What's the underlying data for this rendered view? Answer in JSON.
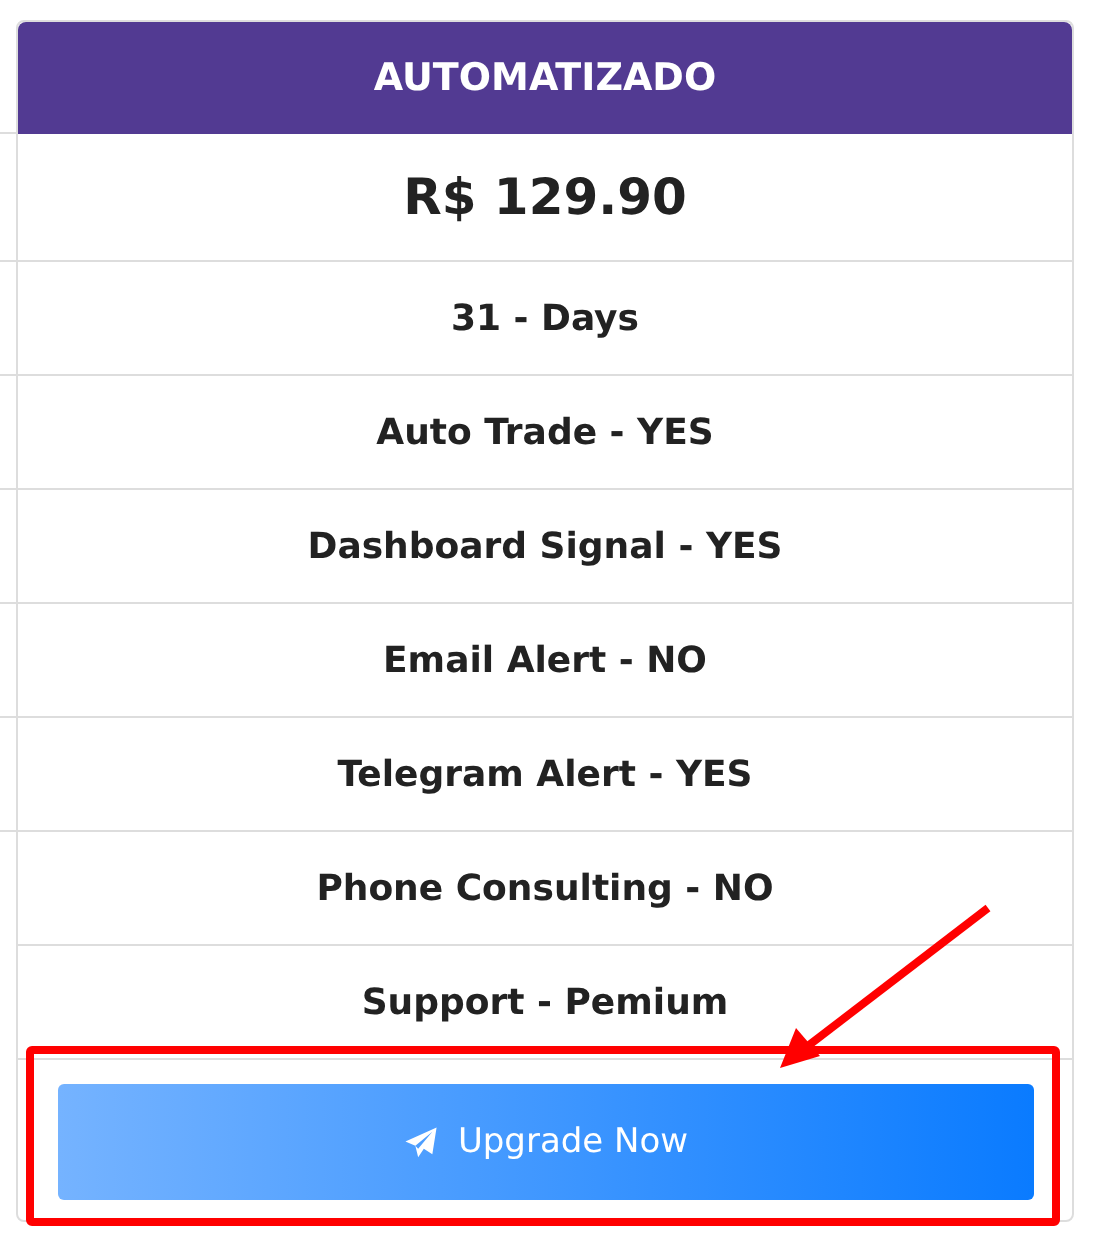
{
  "plan": {
    "title": "AUTOMATIZADO",
    "price": "R$ 129.90",
    "features": [
      "31 - Days",
      "Auto Trade - YES",
      "Dashboard Signal - YES",
      "Email Alert - NO",
      "Telegram Alert - YES",
      "Phone Consulting - NO",
      "Support - Pemium"
    ],
    "button": "Upgrade Now"
  }
}
